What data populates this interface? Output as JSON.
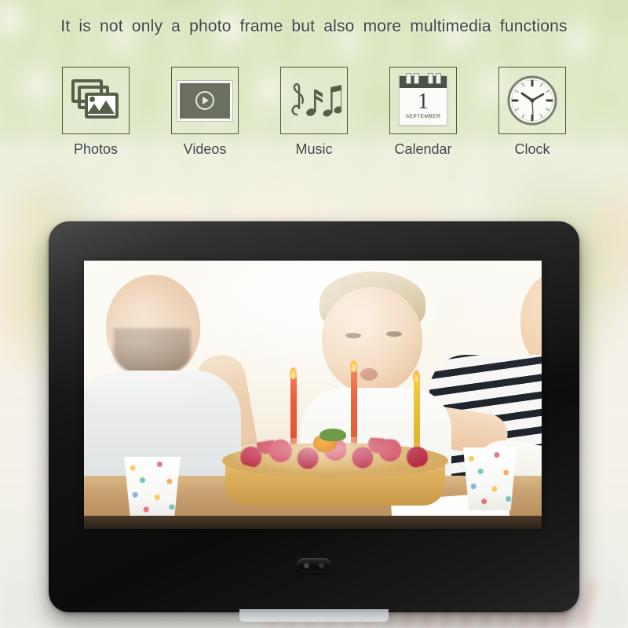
{
  "headline": "It is not only a photo frame but also more multimedia functions",
  "features": [
    {
      "label": "Photos",
      "icon": "photos-stack-icon"
    },
    {
      "label": "Videos",
      "icon": "video-play-icon"
    },
    {
      "label": "Music",
      "icon": "music-notes-icon"
    },
    {
      "label": "Calendar",
      "icon": "calendar-icon"
    },
    {
      "label": "Clock",
      "icon": "analog-clock-icon"
    }
  ],
  "calendar_icon": {
    "day": "1",
    "month": "SEPTEMBER"
  },
  "device": {
    "name": "digital-photo-frame",
    "bezel_color": "#101010",
    "screen_name": "photo-frame-display",
    "sensor_name": "ir-sensor"
  },
  "colors": {
    "tile_border": "#4b5a34",
    "label_text": "#3f4542",
    "headline_text": "#3d4441",
    "bezel": "#101010",
    "icon_fill": "#55604a"
  }
}
